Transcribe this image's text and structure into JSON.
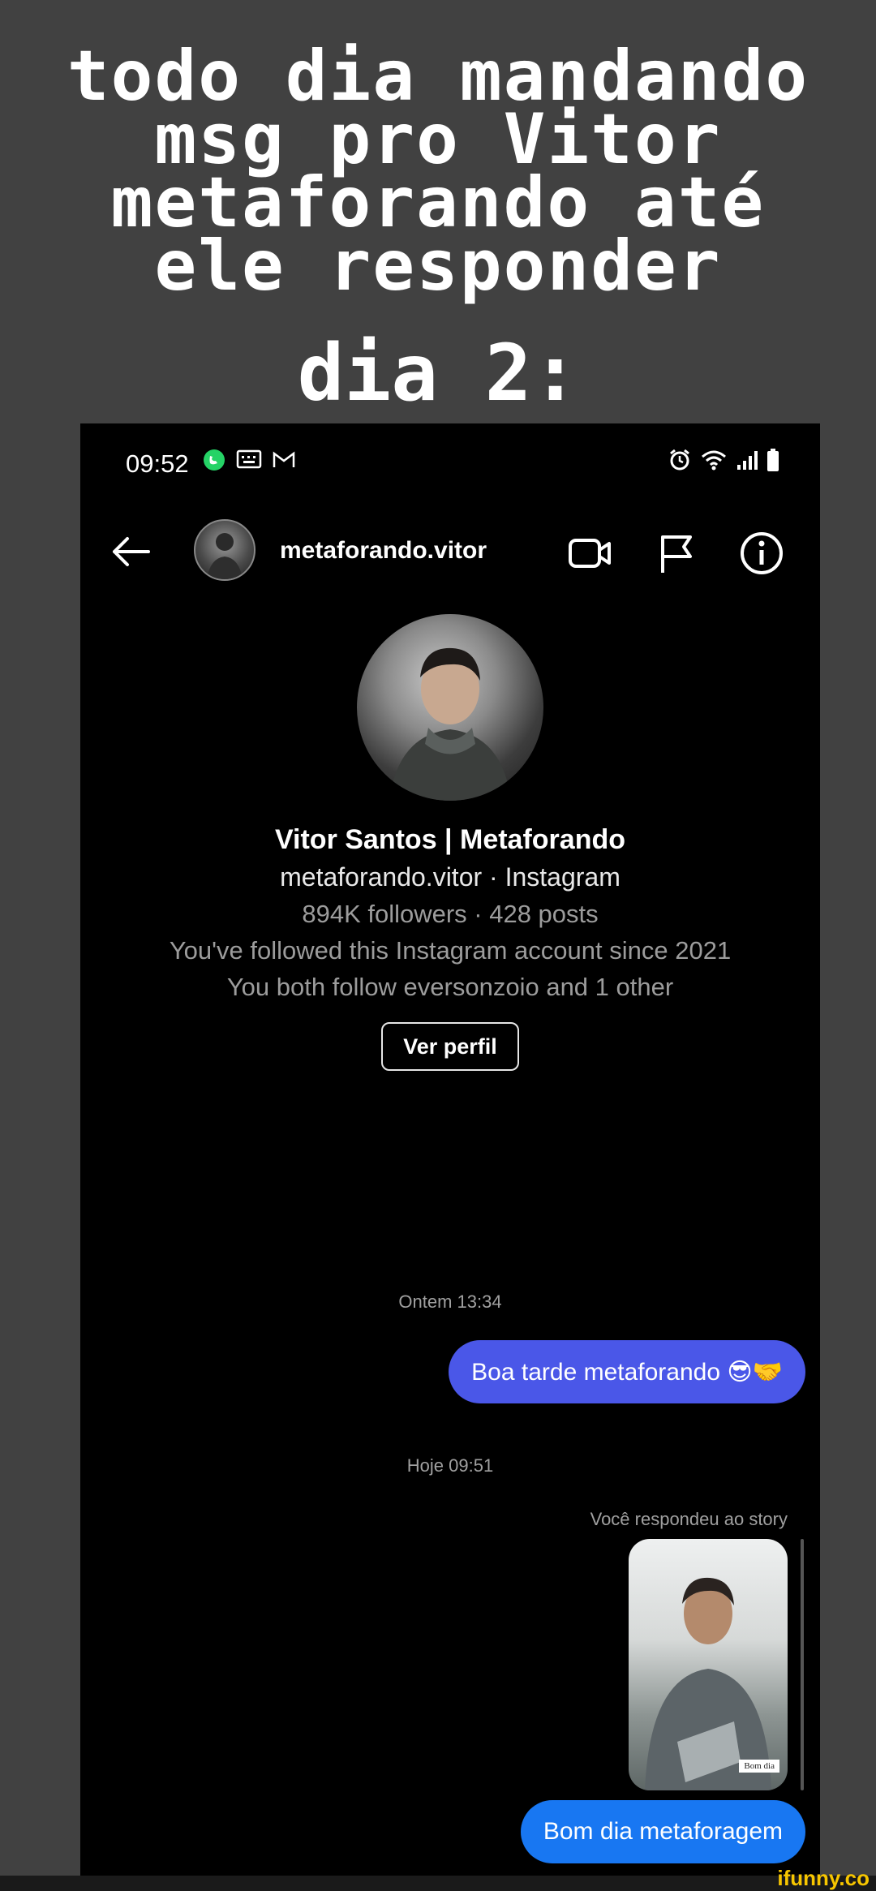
{
  "meme": {
    "title_lines": [
      "todo dia mandando",
      "msg pro Vitor",
      "metaforando até",
      "ele responder"
    ],
    "subtitle": "dia 2:"
  },
  "status_bar": {
    "time": "09:52",
    "left_icons": [
      "whatsapp-icon",
      "keyboard-icon",
      "gmail-icon"
    ],
    "right_icons": [
      "alarm-icon",
      "wifi-icon",
      "signal-icon",
      "battery-icon"
    ]
  },
  "header": {
    "username": "metaforando.vitor",
    "icons": [
      "back-arrow-icon",
      "video-call-icon",
      "flag-icon",
      "info-icon"
    ]
  },
  "profile": {
    "name": "Vitor Santos | Metaforando",
    "handle_line": "metaforando.vitor · Instagram",
    "stats_line": "894K followers · 428 posts",
    "followed_since": "You've followed this Instagram account since 2021",
    "mutuals": "You both follow eversonzoio and 1 other",
    "button_label": "Ver perfil"
  },
  "messages": [
    {
      "type": "timestamp",
      "text": "Ontem 13:34"
    },
    {
      "type": "sent",
      "text": "Boa tarde metaforando 😎🤝"
    },
    {
      "type": "timestamp",
      "text": "Hoje 09:51"
    },
    {
      "type": "story_reply_label",
      "text": "Você respondeu ao story"
    },
    {
      "type": "story_caption",
      "text": "Bom dia"
    },
    {
      "type": "sent",
      "text": "Bom dia metaforagem"
    }
  ],
  "watermark": "ifunny.co",
  "colors": {
    "background": "#414141",
    "phone_bg": "#000000",
    "bubble_purple": "#4a57e8",
    "bubble_blue": "#1877f2",
    "watermark": "#f7c600"
  }
}
